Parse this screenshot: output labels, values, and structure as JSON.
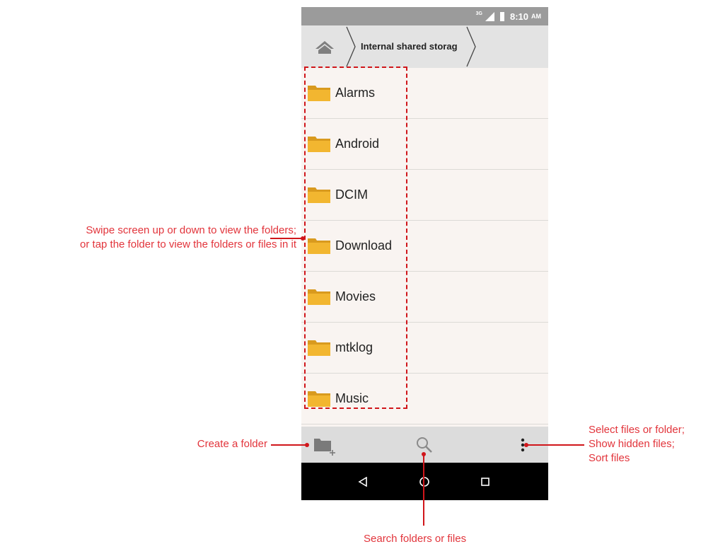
{
  "status_bar": {
    "network": "3G",
    "time": "8:10",
    "ampm": "AM"
  },
  "pathbar": {
    "home_icon": "home-icon",
    "crumb": "Internal shared storag"
  },
  "folders": [
    {
      "name": "Alarms",
      "icon": "folder-icon"
    },
    {
      "name": "Android",
      "icon": "folder-icon"
    },
    {
      "name": "DCIM",
      "icon": "folder-icon"
    },
    {
      "name": "Download",
      "icon": "folder-icon"
    },
    {
      "name": "Movies",
      "icon": "folder-icon"
    },
    {
      "name": "mtklog",
      "icon": "folder-icon"
    },
    {
      "name": "Music",
      "icon": "folder-icon"
    }
  ],
  "bottom_bar": {
    "icons": [
      "new-folder-icon",
      "search-icon",
      "more-vert-icon"
    ]
  },
  "nav_bar": {
    "icons": [
      "back-icon",
      "home-circle-icon",
      "recents-icon"
    ]
  },
  "callouts": {
    "folders_line1": "Swipe screen up or down to view the folders;",
    "folders_line2": "or tap the folder to view the folders or files in it",
    "create": "Create a folder",
    "more_line1": "Select files or folder;",
    "more_line2": "Show hidden files;",
    "more_line3": "Sort files",
    "search": "Search folders or files"
  },
  "colors": {
    "accent": "#d0161b",
    "callout_text": "#e2343b",
    "folder": "#f2b630",
    "statusbar": "#9b9b9b"
  }
}
